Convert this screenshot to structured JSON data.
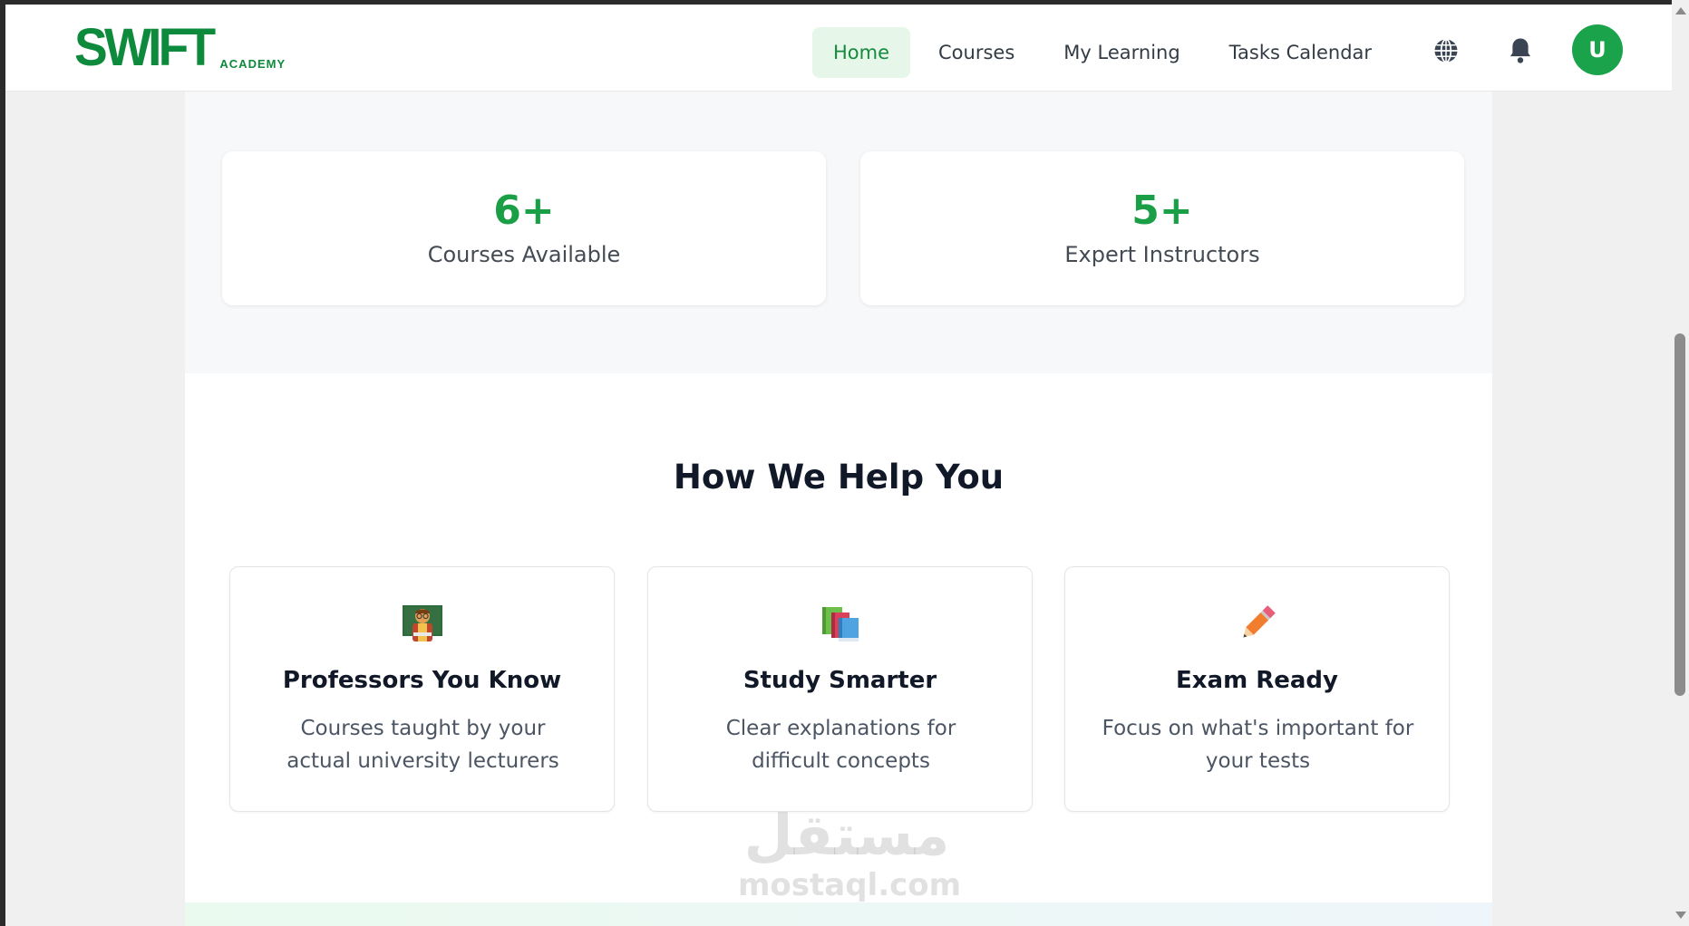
{
  "brand": {
    "name": "SWIFT",
    "subtitle": "ACADEMY"
  },
  "nav": {
    "items": [
      {
        "label": "Home",
        "active": true
      },
      {
        "label": "Courses",
        "active": false
      },
      {
        "label": "My Learning",
        "active": false
      },
      {
        "label": "Tasks Calendar",
        "active": false
      }
    ],
    "language_icon": "globe-icon",
    "notifications_icon": "bell-icon",
    "avatar_initial": "U"
  },
  "stats": [
    {
      "value": "6+",
      "label": "Courses Available"
    },
    {
      "value": "5+",
      "label": "Expert Instructors"
    }
  ],
  "help_section": {
    "title": "How We Help You",
    "features": [
      {
        "icon": "teacher-icon",
        "title": "Professors You Know",
        "description": "Courses taught by your actual university lecturers"
      },
      {
        "icon": "books-icon",
        "title": "Study Smarter",
        "description": "Clear explanations for difficult concepts"
      },
      {
        "icon": "pencil-icon",
        "title": "Exam Ready",
        "description": "Focus on what's important for your tests"
      }
    ]
  },
  "watermark": {
    "arabic": "مستقل",
    "latin": "mostaql.com"
  },
  "colors": {
    "brand_green": "#0e8a3c",
    "accent_green": "#1a9e46",
    "active_nav_bg": "#e6f7ea"
  }
}
